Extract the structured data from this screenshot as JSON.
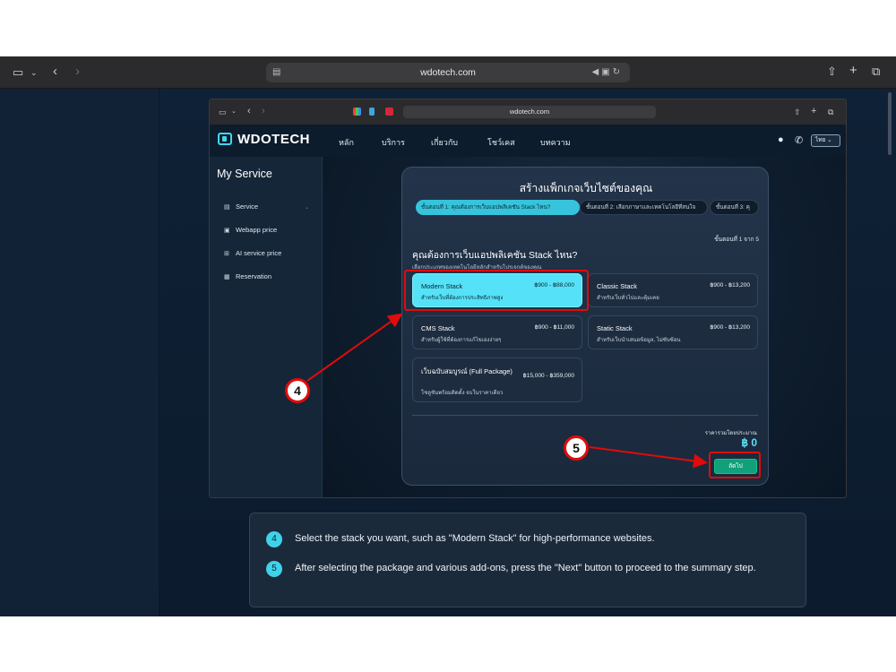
{
  "outer_browser": {
    "url": "wdotech.com"
  },
  "inner_browser": {
    "url": "wdotech.com"
  },
  "site": {
    "logo_text": "WDOTECH",
    "nav": [
      "หลัก",
      "บริการ",
      "เกี่ยวกับ",
      "โชว์เคส",
      "บทความ"
    ],
    "language": "ไทย"
  },
  "sidebar": {
    "title": "My Service",
    "items": [
      {
        "label": "Service",
        "icon": "server-icon"
      },
      {
        "label": "Webapp price",
        "icon": "document-icon"
      },
      {
        "label": "AI service price",
        "icon": "chip-icon"
      },
      {
        "label": "Reservation",
        "icon": "calendar-icon"
      }
    ]
  },
  "builder": {
    "title": "สร้างแพ็กเกจเว็บไซต์ของคุณ",
    "steps": [
      "ขั้นตอนที่ 1: คุณต้องการเว็บแอปพลิเคชัน Stack ไหน?",
      "ขั้นตอนที่ 2: เลือกภาษาและเทคโนโลยีที่สนใจ",
      "ขั้นตอนที่ 3: คุ"
    ],
    "step_count": "ขั้นตอนที่ 1 จาก 5",
    "question": "คุณต้องการเว็บแอปพลิเคชัน Stack ไหน?",
    "question_sub": "เลือกประเภทของเทคโนโลยีหลักสำหรับโปรเจกต์ของคุณ",
    "options": [
      {
        "name": "Modern Stack",
        "price": "฿900 - ฿88,000",
        "desc": "สำหรับเว็บที่ต้องการประสิทธิภาพสูง",
        "selected": true
      },
      {
        "name": "Classic Stack",
        "price": "฿900 - ฿13,200",
        "desc": "สำหรับเว็บทั่วไปและคุ้มเคย",
        "selected": false
      },
      {
        "name": "CMS Stack",
        "price": "฿900 - ฿11,000",
        "desc": "สำหรับผู้ใช้ที่ต้องการแก้ไขเองง่ายๆ",
        "selected": false
      },
      {
        "name": "Static Stack",
        "price": "฿900 - ฿13,200",
        "desc": "สำหรับเว็บนำเสนอข้อมูล, ไม่ซับซ้อน",
        "selected": false
      },
      {
        "name": "เว็บฉบับสมบูรณ์ (Full Package)",
        "price": "฿15,000 - ฿359,000",
        "desc": "โซลูชันพร้อมติดตั้ง จบในราคาเดียว",
        "selected": false
      }
    ],
    "total_label": "ราคารวมโดยประมาณ",
    "total_value": "฿ 0",
    "next_label": "ถัดไป"
  },
  "annotations": [
    {
      "number": "4",
      "text": "Select the stack you want, such as \"Modern Stack\" for high-performance websites."
    },
    {
      "number": "5",
      "text": "After selecting the package and various add-ons, press the \"Next\" button to proceed to the summary step."
    }
  ],
  "colors": {
    "accent": "#36c4dc",
    "highlight": "#e00b0b",
    "next_button": "#10a07a"
  }
}
